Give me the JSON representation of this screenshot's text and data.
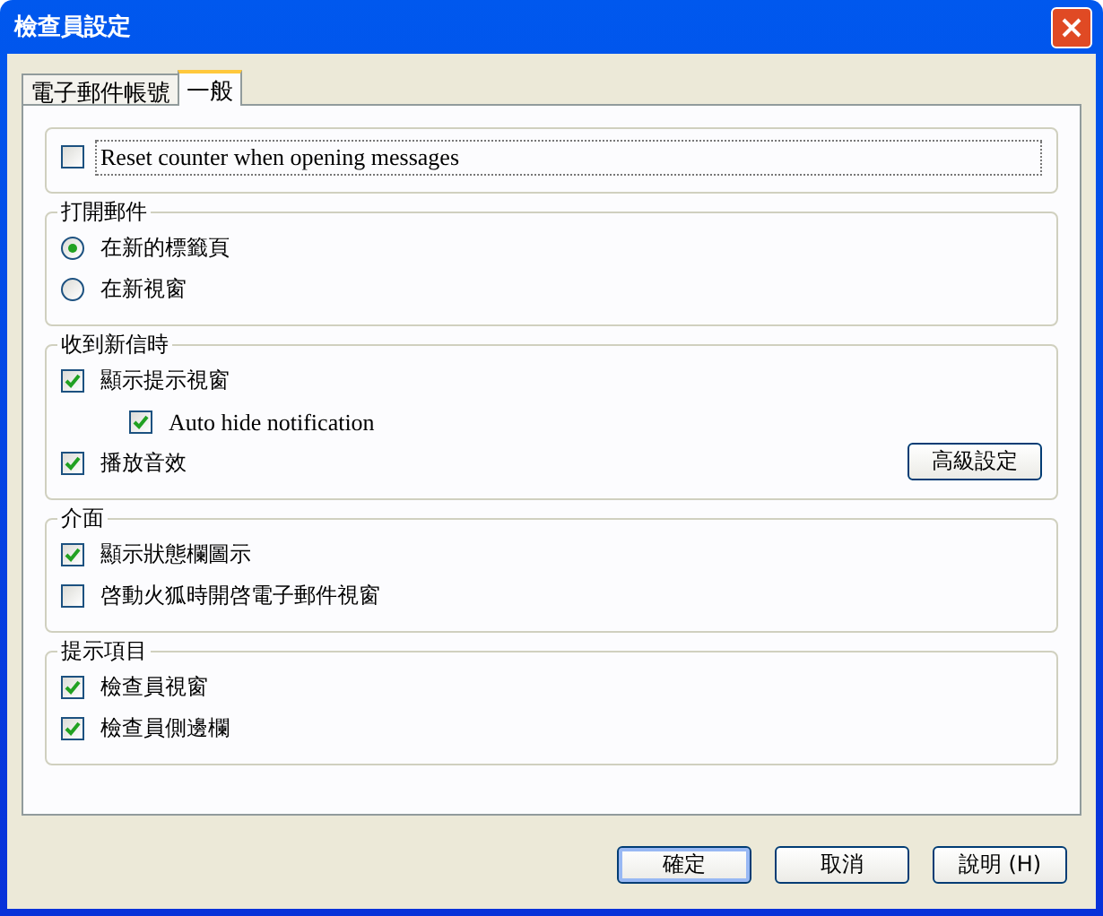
{
  "window": {
    "title": "檢查員設定"
  },
  "tabs": [
    {
      "label": "電子郵件帳號",
      "selected": false
    },
    {
      "label": "一般",
      "selected": true
    }
  ],
  "groups": [
    {
      "items": [
        {
          "kind": "checkbox",
          "label": "Reset counter when opening messages",
          "checked": false,
          "focused": true
        }
      ]
    },
    {
      "title": "打開郵件",
      "items": [
        {
          "kind": "radio",
          "label": "在新的標籤頁",
          "selected": true
        },
        {
          "kind": "radio",
          "label": "在新視窗",
          "selected": false
        }
      ]
    },
    {
      "title": "收到新信時",
      "items": [
        {
          "kind": "checkbox",
          "label": "顯示提示視窗",
          "checked": true,
          "children": [
            {
              "kind": "checkbox",
              "label": "Auto hide notification",
              "checked": true
            }
          ]
        },
        {
          "kind": "checkbox",
          "label": "播放音效",
          "checked": true
        }
      ],
      "button": "高級設定"
    },
    {
      "title": "介面",
      "items": [
        {
          "kind": "checkbox",
          "label": "顯示狀態欄圖示",
          "checked": true
        },
        {
          "kind": "checkbox",
          "label": "啓動火狐時開啓電子郵件視窗",
          "checked": false
        }
      ]
    },
    {
      "title": "提示項目",
      "items": [
        {
          "kind": "checkbox",
          "label": "檢查員視窗",
          "checked": true
        },
        {
          "kind": "checkbox",
          "label": "檢查員側邊欄",
          "checked": true
        }
      ]
    }
  ],
  "buttons": [
    {
      "label": "確定",
      "default": true
    },
    {
      "label": "取消",
      "default": false
    },
    {
      "label": "說明 (H)",
      "default": false
    }
  ]
}
